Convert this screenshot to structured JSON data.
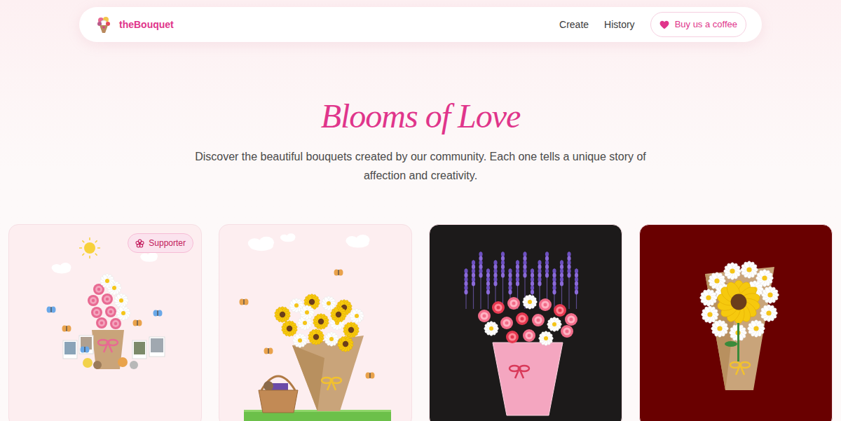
{
  "brand": {
    "name": "theBouquet"
  },
  "nav": {
    "links": [
      {
        "label": "Create"
      },
      {
        "label": "History"
      }
    ],
    "cta": {
      "label": "Buy us a coffee"
    }
  },
  "hero": {
    "title": "Blooms of Love",
    "description": "Discover the beautiful bouquets created by our community. Each one tells a unique story of affection and creativity."
  },
  "bouquets": [
    {
      "kind": "mixed",
      "color": "#fdeef0",
      "supporter": true,
      "badge": "Supporter"
    },
    {
      "kind": "basket",
      "color": "#fdeef0",
      "supporter": false
    },
    {
      "kind": "lavender",
      "color": "#1c1a1a",
      "supporter": false
    },
    {
      "kind": "sunflower",
      "color": "#690000",
      "supporter": false
    }
  ]
}
